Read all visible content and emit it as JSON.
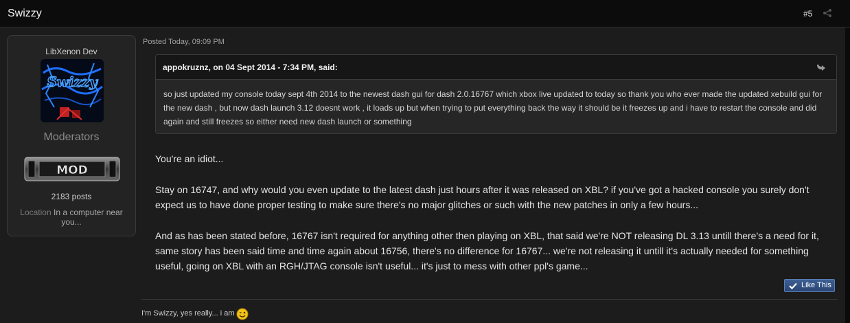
{
  "header": {
    "author": "Swizzy",
    "post_number": "#5"
  },
  "user": {
    "title": "LibXenon Dev",
    "avatar_text": "Swizzy",
    "group": "Moderators",
    "badge_text": "MOD",
    "posts": "2183 posts",
    "location_label": "Location",
    "location_value": "In a computer near you..."
  },
  "post": {
    "posted": "Posted Today, 09:09 PM",
    "quote_citation": "appokruznz, on 04 Sept 2014 - 7:34 PM, said:",
    "quote_text": "so just updated my console today sept 4th 2014 to the newest dash gui for dash 2.0.16767 which xbox live updated to today so thank you who ever made the updated xebuild gui for the new dash , but now dash launch 3.12 doesnt work , it loads up but when trying to put everything back the way it should be it freezes up and i have to restart the console and did again and still freezes so either need new dash launch or something",
    "paragraphs": [
      "You're an idiot...",
      "Stay on 16747, and why would you even update to the latest dash just hours after it was released on XBL? if you've got a hacked console you surely don't expect us to have done proper testing to make sure there's no major glitches or such with the new patches in only a few hours...",
      "And as has been stated before, 16767 isn't required for anything other then playing on XBL, that said we're NOT releasing DL 3.13 untill there's a need for it, same story has been said time and time again about 16756, there's no difference for 16767... we're not releasing it untill it's actually needed for something useful, going on XBL with an RGH/JTAG console isn't useful... it's just to mess with other ppl's game..."
    ],
    "like_label": "Like This",
    "signature": "I'm Swizzy, yes really... i am"
  },
  "icons": {
    "share": "share-icon",
    "quote": "quote-reply-icon",
    "like": "check-icon",
    "smiley": "wink-smiley-icon"
  },
  "colors": {
    "background": "#1c1c1c",
    "topbar": "#0c0c0c",
    "like_button": "#2f4d7f",
    "avatar_accent": "#1e6fff",
    "avatar_red": "#c02020"
  }
}
